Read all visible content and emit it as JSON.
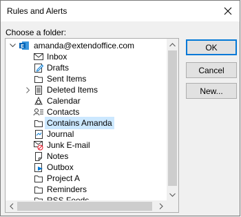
{
  "window": {
    "title": "Rules and Alerts"
  },
  "prompt": "Choose a folder:",
  "tree": {
    "account": "amanda@extendoffice.com",
    "folders": [
      {
        "label": "Inbox",
        "icon": "inbox-icon"
      },
      {
        "label": "Drafts",
        "icon": "drafts-icon"
      },
      {
        "label": "Sent Items",
        "icon": "sent-items-icon"
      },
      {
        "label": "Deleted Items",
        "icon": "deleted-items-icon"
      },
      {
        "label": "Calendar",
        "icon": "calendar-icon"
      },
      {
        "label": "Contacts",
        "icon": "contacts-icon"
      },
      {
        "label": "Contains Amanda",
        "icon": "folder-icon"
      },
      {
        "label": "Journal",
        "icon": "journal-icon"
      },
      {
        "label": "Junk E-mail",
        "icon": "junk-email-icon"
      },
      {
        "label": "Notes",
        "icon": "notes-icon"
      },
      {
        "label": "Outbox",
        "icon": "outbox-icon"
      },
      {
        "label": "Project A",
        "icon": "folder-icon"
      },
      {
        "label": "Reminders",
        "icon": "folder-icon"
      },
      {
        "label": "RSS Feeds",
        "icon": "rss-feeds-icon"
      }
    ]
  },
  "buttons": {
    "ok": "OK",
    "cancel": "Cancel",
    "new": "New..."
  }
}
